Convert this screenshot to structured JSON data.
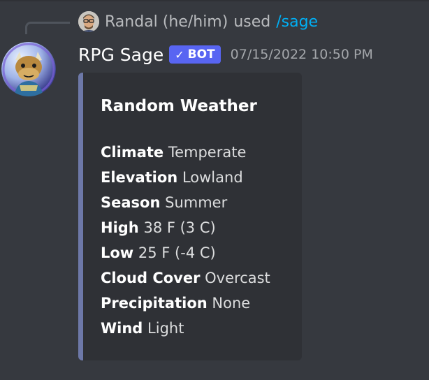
{
  "reply": {
    "user_name": "Randal (he/him)",
    "used_text": "used",
    "command": "/sage"
  },
  "message": {
    "username": "RPG Sage",
    "badge_label": "BOT",
    "badge_icon": "check-icon",
    "timestamp": "07/15/2022 10:50 PM"
  },
  "embed": {
    "accent_color": "#6d78a8",
    "title": "Random Weather",
    "fields": [
      {
        "label": "Climate",
        "value": "Temperate"
      },
      {
        "label": "Elevation",
        "value": "Lowland"
      },
      {
        "label": "Season",
        "value": "Summer"
      },
      {
        "label": "High",
        "value": "38 F (3 C)"
      },
      {
        "label": "Low",
        "value": "25 F (-4 C)"
      },
      {
        "label": "Cloud Cover",
        "value": "Overcast"
      },
      {
        "label": "Precipitation",
        "value": "None"
      },
      {
        "label": "Wind",
        "value": "Light"
      }
    ]
  }
}
